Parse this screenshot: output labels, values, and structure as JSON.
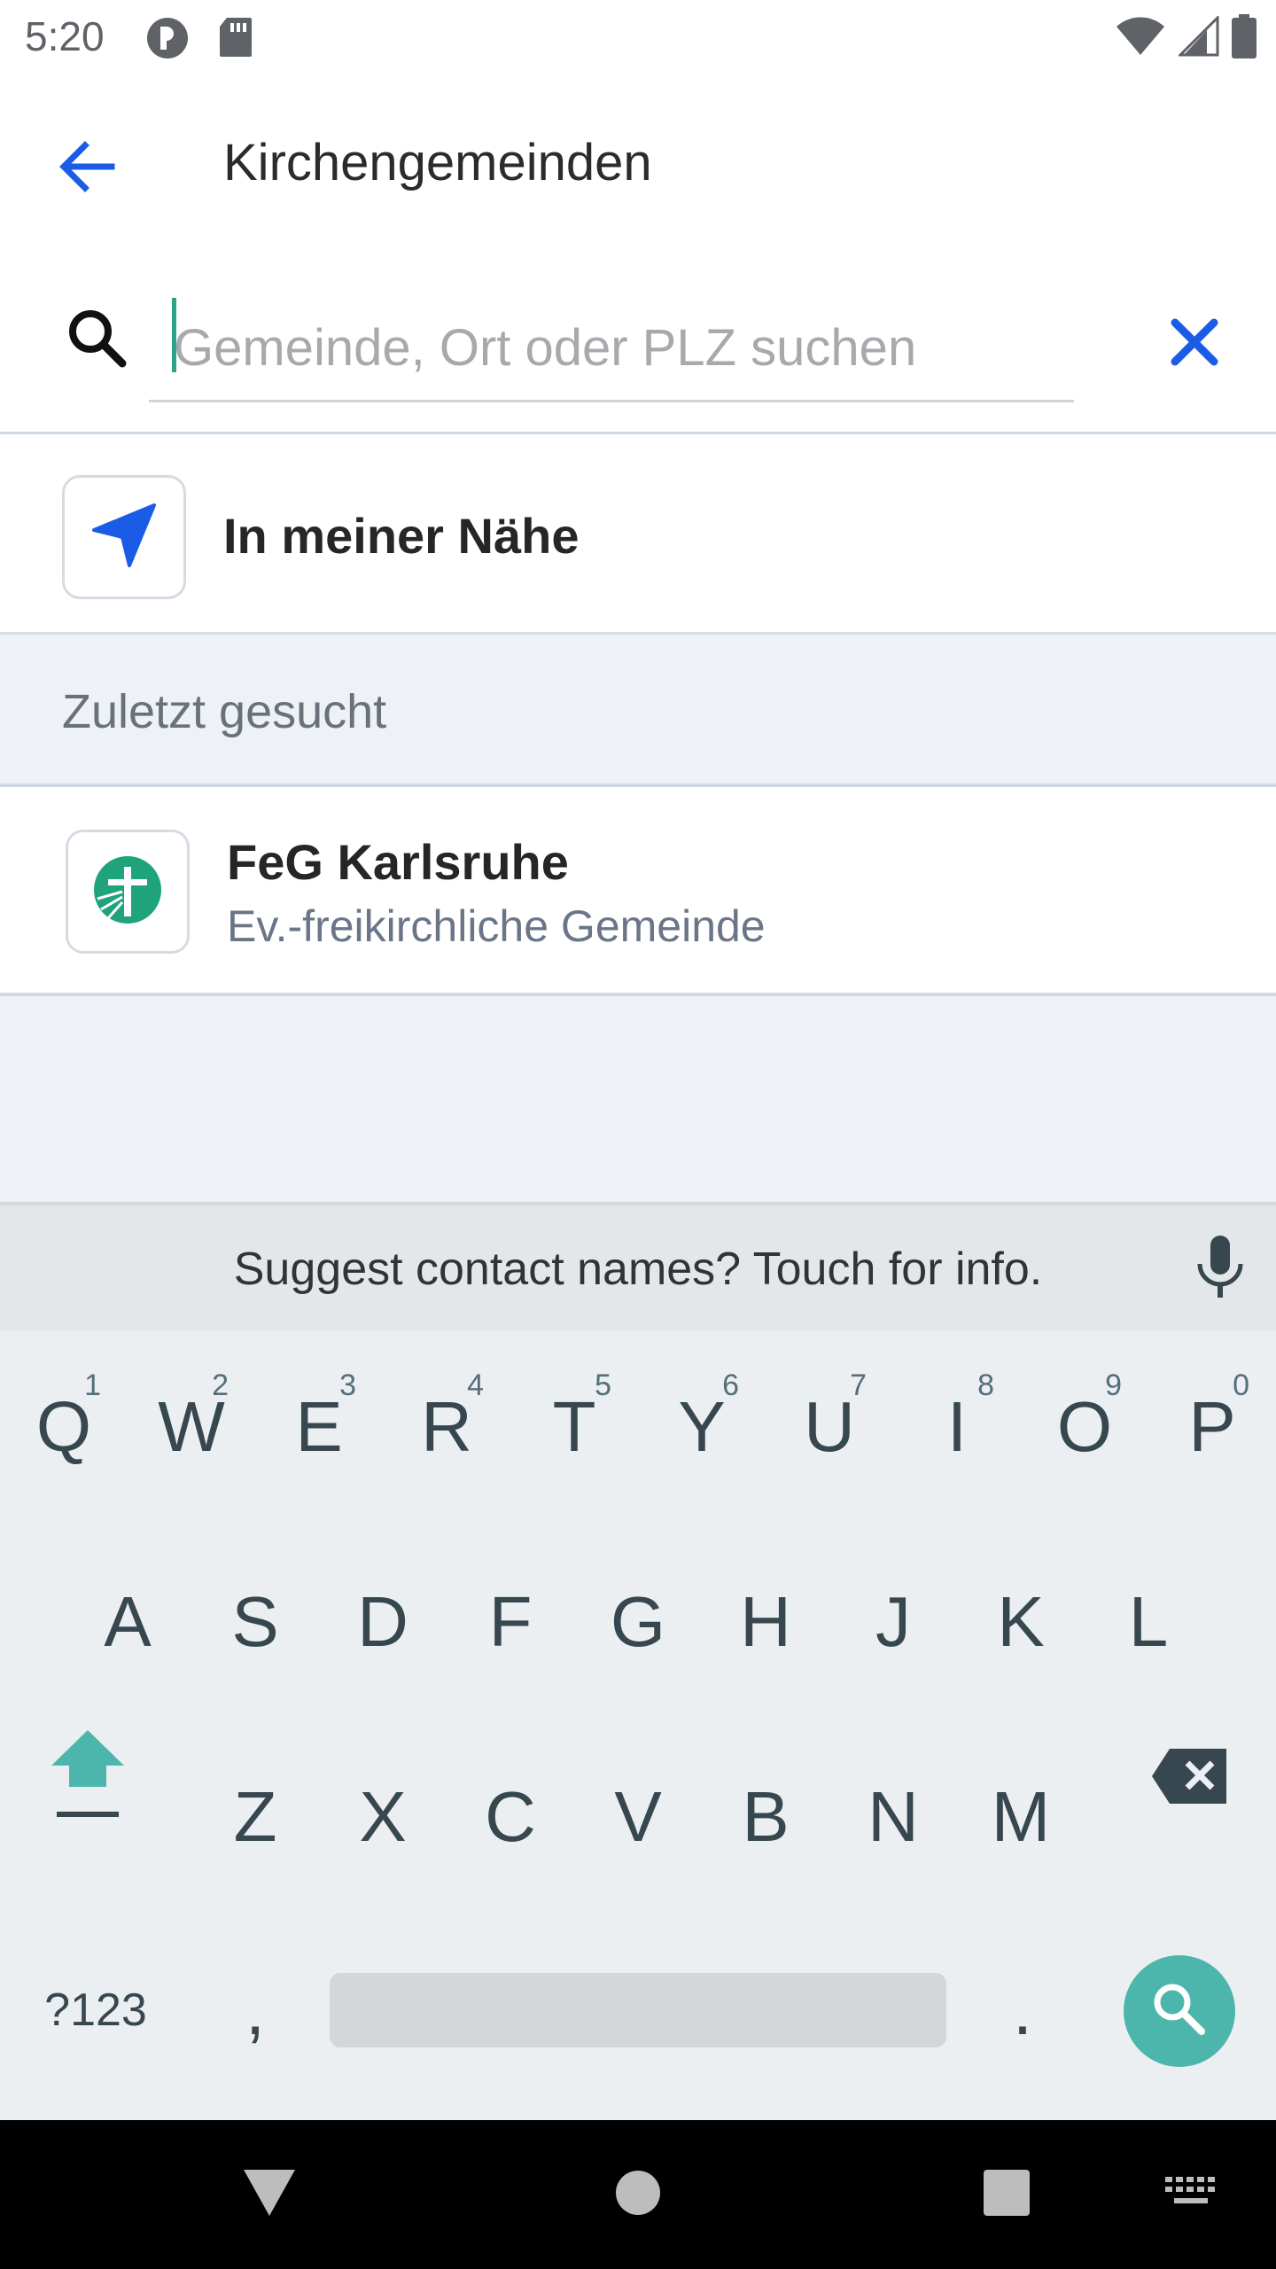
{
  "status_bar": {
    "time": "5:20",
    "icons": [
      "app-notification-icon",
      "sd-card-icon",
      "wifi-icon",
      "cell-signal-icon",
      "battery-icon"
    ]
  },
  "app_bar": {
    "title": "Kirchengemeinden",
    "back_icon": "arrow-back-icon"
  },
  "search": {
    "value": "",
    "placeholder": "Gemeinde, Ort oder PLZ suchen",
    "clear_icon": "close-icon"
  },
  "nearby": {
    "label": "In meiner Nähe",
    "icon": "navigation-arrow-icon"
  },
  "recent": {
    "title": "Zuletzt gesucht",
    "items": [
      {
        "name": "FeG Karlsruhe",
        "subtitle": "Ev.-freikirchliche Gemeinde"
      }
    ]
  },
  "keyboard": {
    "suggestion": "Suggest contact names? Touch for info.",
    "row1": [
      {
        "k": "Q",
        "h": "1"
      },
      {
        "k": "W",
        "h": "2"
      },
      {
        "k": "E",
        "h": "3"
      },
      {
        "k": "R",
        "h": "4"
      },
      {
        "k": "T",
        "h": "5"
      },
      {
        "k": "Y",
        "h": "6"
      },
      {
        "k": "U",
        "h": "7"
      },
      {
        "k": "I",
        "h": "8"
      },
      {
        "k": "O",
        "h": "9"
      },
      {
        "k": "P",
        "h": "0"
      }
    ],
    "row2": [
      "A",
      "S",
      "D",
      "F",
      "G",
      "H",
      "J",
      "K",
      "L"
    ],
    "row3": [
      "Z",
      "X",
      "C",
      "V",
      "B",
      "N",
      "M"
    ],
    "symbols_label": "?123",
    "comma": ",",
    "period": "."
  },
  "colors": {
    "accent_blue": "#1a5ce6",
    "keyboard_teal": "#4db6ac",
    "church_green": "#1fa37a",
    "list_bg": "#eef2f7"
  }
}
